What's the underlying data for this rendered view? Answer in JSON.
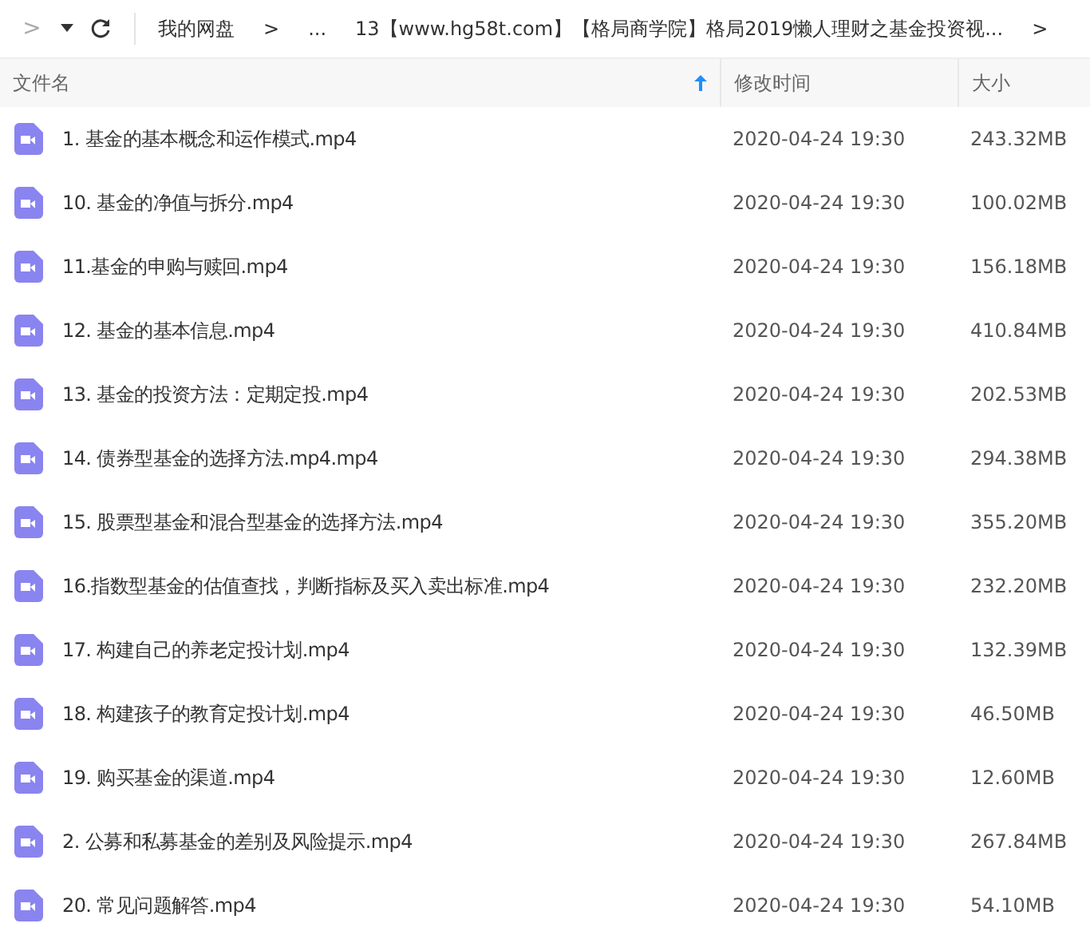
{
  "toolbar": {
    "forward": ">",
    "breadcrumbs": [
      "我的网盘",
      ">",
      "...",
      "13【www.hg58t.com】【格局商学院】格局2019懒人理财之基金投资视...",
      ">"
    ]
  },
  "table": {
    "columns": [
      {
        "label": "文件名",
        "sorted": true
      },
      {
        "label": "修改时间",
        "sorted": false
      },
      {
        "label": "大小",
        "sorted": false
      }
    ],
    "rows": [
      {
        "name": "1. 基金的基本概念和运作模式.mp4",
        "time": "2020-04-24 19:30",
        "size": "243.32MB"
      },
      {
        "name": "10. 基金的净值与拆分.mp4",
        "time": "2020-04-24 19:30",
        "size": "100.02MB"
      },
      {
        "name": "11.基金的申购与赎回.mp4",
        "time": "2020-04-24 19:30",
        "size": "156.18MB"
      },
      {
        "name": "12. 基金的基本信息.mp4",
        "time": "2020-04-24 19:30",
        "size": "410.84MB"
      },
      {
        "name": "13. 基金的投资方法：定期定投.mp4",
        "time": "2020-04-24 19:30",
        "size": "202.53MB"
      },
      {
        "name": "14. 债券型基金的选择方法.mp4.mp4",
        "time": "2020-04-24 19:30",
        "size": "294.38MB"
      },
      {
        "name": "15. 股票型基金和混合型基金的选择方法.mp4",
        "time": "2020-04-24 19:30",
        "size": "355.20MB"
      },
      {
        "name": "16.指数型基金的估值查找，判断指标及买入卖出标准.mp4",
        "time": "2020-04-24 19:30",
        "size": "232.20MB"
      },
      {
        "name": "17. 构建自己的养老定投计划.mp4",
        "time": "2020-04-24 19:30",
        "size": "132.39MB"
      },
      {
        "name": "18. 构建孩子的教育定投计划.mp4",
        "time": "2020-04-24 19:30",
        "size": "46.50MB"
      },
      {
        "name": "19. 购买基金的渠道.mp4",
        "time": "2020-04-24 19:30",
        "size": "12.60MB"
      },
      {
        "name": "2. 公募和私募基金的差别及风险提示.mp4",
        "time": "2020-04-24 19:30",
        "size": "267.84MB"
      },
      {
        "name": "20. 常见问题解答.mp4",
        "time": "2020-04-24 19:30",
        "size": "54.10MB"
      }
    ]
  }
}
